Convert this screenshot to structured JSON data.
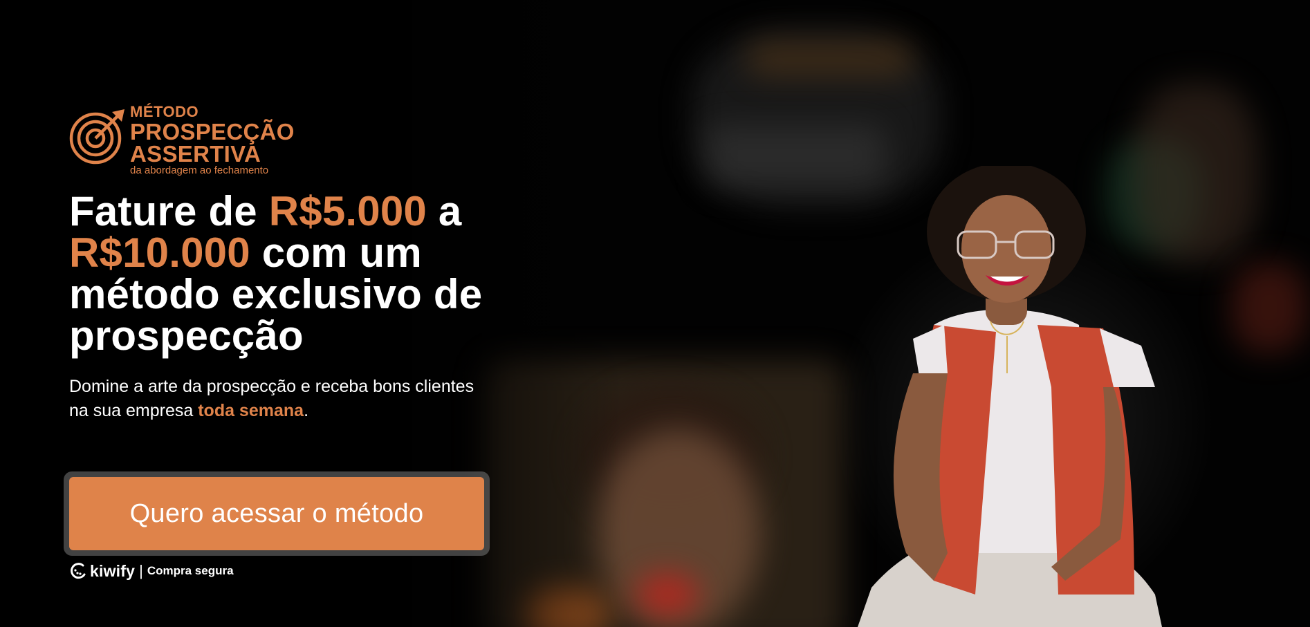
{
  "logo": {
    "line1": "MÉTODO",
    "line2": "PROSPECÇÃO",
    "line3": "ASSERTIVA",
    "tagline": "da abordagem ao fechamento",
    "icon": "target-arrow-icon"
  },
  "hero": {
    "headline": {
      "p1": "Fature de ",
      "amount1": "R$5.000",
      "p2": " a",
      "amount2": "R$10.000",
      "p3": " com um",
      "p4": "método exclusivo de",
      "p5": "prospecção"
    },
    "subheadline": {
      "text": "Domine a arte da prospecção e receba bons clientes na sua empresa ",
      "highlight": "toda semana",
      "end": "."
    }
  },
  "cta": {
    "label": "Quero acessar o método"
  },
  "checkout": {
    "brand": "kiwify",
    "separator": "|",
    "secure_label": "Compra segura"
  },
  "colors": {
    "accent": "#df834a",
    "background": "#000000",
    "text": "#ffffff"
  }
}
